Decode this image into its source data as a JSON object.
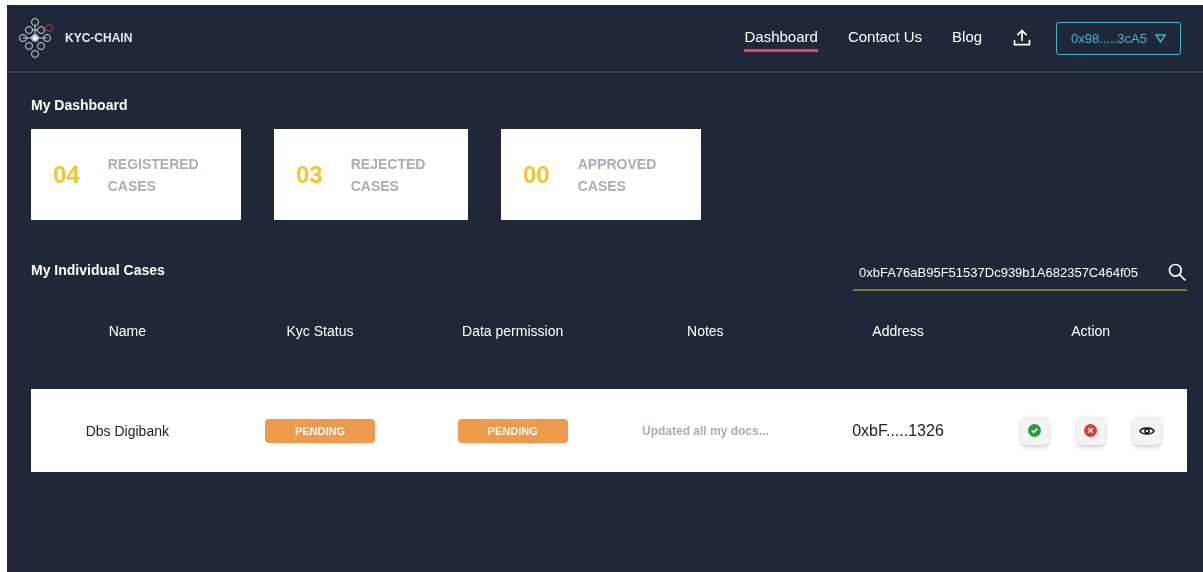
{
  "header": {
    "logo_text": "KYC-CHAIN",
    "nav": [
      {
        "label": "Dashboard",
        "selected": true
      },
      {
        "label": "Contact Us",
        "selected": false
      },
      {
        "label": "Blog",
        "selected": false
      }
    ],
    "account": "0x98.....3cA5"
  },
  "dashboard": {
    "title": "My Dashboard",
    "stats": [
      {
        "value": "04",
        "label_line1": "REGISTERED",
        "label_line2": "CASES"
      },
      {
        "value": "03",
        "label_line1": "REJECTED",
        "label_line2": "CASES"
      },
      {
        "value": "00",
        "label_line1": "APPROVED",
        "label_line2": "CASES"
      }
    ]
  },
  "cases": {
    "title": "My Individual Cases",
    "search": {
      "value": "0xbFA76aB95F51537Dc939b1A682357C464f05"
    },
    "table": {
      "columns": [
        "Name",
        "Kyc Status",
        "Data permission",
        "Notes",
        "Address",
        "Action"
      ],
      "rows": [
        {
          "name": "Dbs Digibank",
          "kyc_status": {
            "label": "PENDING",
            "kind": "pending"
          },
          "data_permission": {
            "label": "PENDING",
            "kind": "pending"
          },
          "notes": "Updated all my docs...",
          "address": "0xbF.....1326"
        }
      ]
    }
  }
}
